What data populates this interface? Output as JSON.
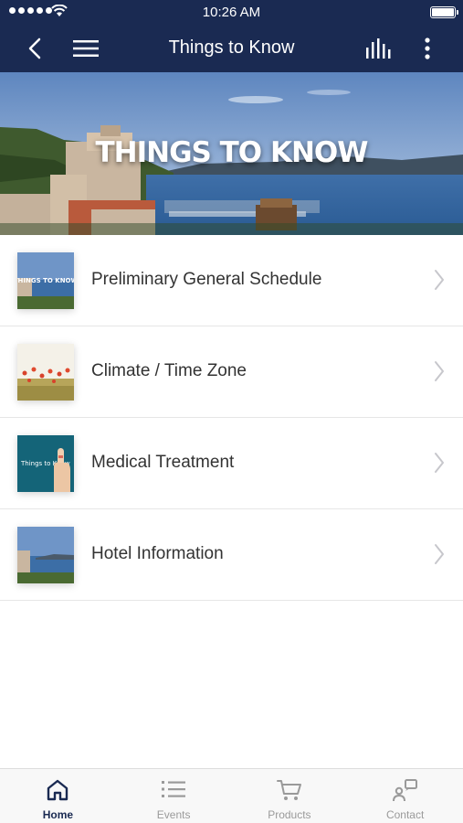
{
  "status_bar": {
    "time": "10:26 AM"
  },
  "header": {
    "title": "Things to Know"
  },
  "hero": {
    "title": "THINGS TO KNOW"
  },
  "thumb_text": {
    "schedule": "THINGS TO KNOW",
    "medical": "Things to Know"
  },
  "list": {
    "items": [
      {
        "label": "Preliminary General Schedule",
        "thumb_icon": "resort-lake-thumbnail"
      },
      {
        "label": "Climate / Time Zone",
        "thumb_icon": "poppy-field-thumbnail"
      },
      {
        "label": "Medical Treatment",
        "thumb_icon": "finger-thumbnail"
      },
      {
        "label": "Hotel Information",
        "thumb_icon": "hotel-lake-thumbnail"
      }
    ]
  },
  "tab_bar": {
    "tabs": [
      {
        "label": "Home",
        "icon": "home-icon",
        "active": true
      },
      {
        "label": "Events",
        "icon": "list-icon",
        "active": false
      },
      {
        "label": "Products",
        "icon": "cart-icon",
        "active": false
      },
      {
        "label": "Contact",
        "icon": "contact-icon",
        "active": false
      }
    ]
  },
  "colors": {
    "nav_background": "#1a2a52",
    "tab_active": "#1a2a52",
    "tab_inactive": "#9a9a9a"
  }
}
